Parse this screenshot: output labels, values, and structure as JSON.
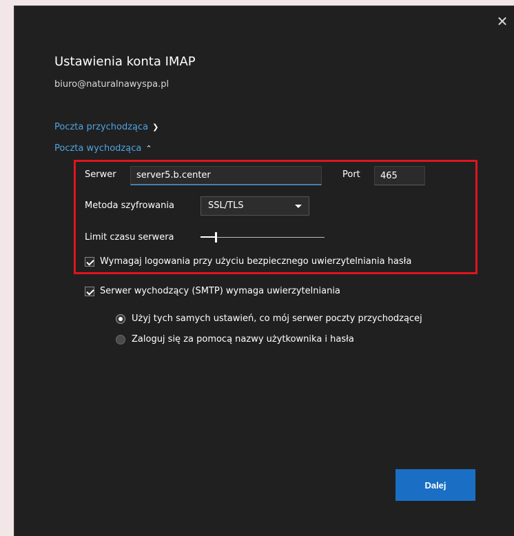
{
  "dialog": {
    "title": "Ustawienia konta IMAP",
    "email": "biuro@naturalnawyspa.pl",
    "close_icon": "close-icon"
  },
  "sections": {
    "incoming_label": "Poczta przychodząca",
    "incoming_chevron": "chevron-down-icon",
    "outgoing_label": "Poczta wychodząca",
    "outgoing_chevron": "chevron-up-icon"
  },
  "outgoing": {
    "server_label": "Serwer",
    "server_value": "server5.b.center",
    "port_label": "Port",
    "port_value": "465",
    "encryption_label": "Metoda szyfrowania",
    "encryption_value": "SSL/TLS",
    "timeout_label": "Limit czasu serwera",
    "timeout_level": 0.12,
    "spa_label": "Wymagaj logowania przy użyciu bezpiecznego uwierzytelniania hasła",
    "spa_checked": true
  },
  "smtp_auth": {
    "label": "Serwer wychodzący (SMTP) wymaga uwierzytelniania",
    "checked": true,
    "option_same": "Użyj tych samych ustawień, co mój serwer poczty przychodzącej",
    "option_login": "Zaloguj się za pomocą nazwy użytkownika i hasła",
    "selected": "same"
  },
  "footer": {
    "next_label": "Dalej"
  },
  "colors": {
    "accent": "#1a6fc4",
    "link": "#4fa3e3",
    "highlight": "#e0141e",
    "background": "#202020"
  }
}
